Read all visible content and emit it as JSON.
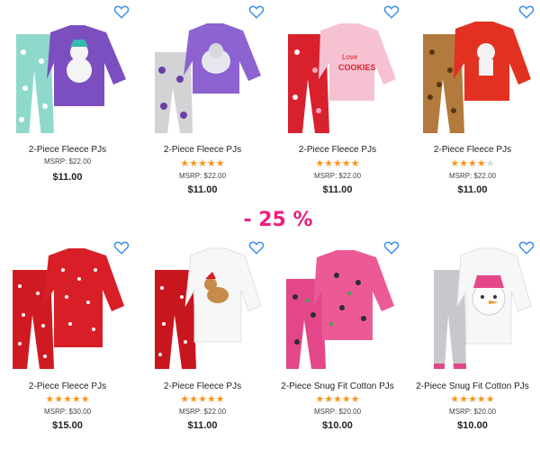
{
  "discount_label": "- 25 %",
  "products": [
    {
      "name": "2-Piece Fleece PJs",
      "rating": null,
      "msrp": "MSRP: $22.00",
      "price": "$11.00",
      "image": "purple-polar-bear-fleece-pjs"
    },
    {
      "name": "2-Piece Fleece PJs",
      "rating": 5,
      "msrp": "MSRP: $22.00",
      "price": "$11.00",
      "image": "purple-mouse-cocoa-fleece-pjs"
    },
    {
      "name": "2-Piece Fleece PJs",
      "rating": 5,
      "msrp": "MSRP: $22.00",
      "price": "$11.00",
      "image": "pink-love-cookies-fleece-pjs"
    },
    {
      "name": "2-Piece Fleece PJs",
      "rating": 4,
      "msrp": "MSRP: $22.00",
      "price": "$11.00",
      "image": "red-cat-leopard-fleece-pjs"
    },
    {
      "name": "2-Piece Fleece PJs",
      "rating": 5,
      "msrp": "MSRP: $30.00",
      "price": "$15.00",
      "image": "red-polka-dot-fleece-pjs"
    },
    {
      "name": "2-Piece Fleece PJs",
      "rating": 5,
      "msrp": "MSRP: $22.00",
      "price": "$11.00",
      "image": "white-puppy-red-dot-fleece-pjs"
    },
    {
      "name": "2-Piece Snug Fit Cotton PJs",
      "rating": 5,
      "msrp": "MSRP: $20.00",
      "price": "$10.00",
      "image": "pink-penguin-cotton-pjs"
    },
    {
      "name": "2-Piece Snug Fit Cotton PJs",
      "rating": 5,
      "msrp": "MSRP: $20.00",
      "price": "$10.00",
      "image": "snowman-cotton-pjs"
    }
  ],
  "colors": {
    "accent_star": "#f7941d",
    "heart_outline": "#3b8ee8",
    "discount_pink": "#ec1f7d"
  }
}
